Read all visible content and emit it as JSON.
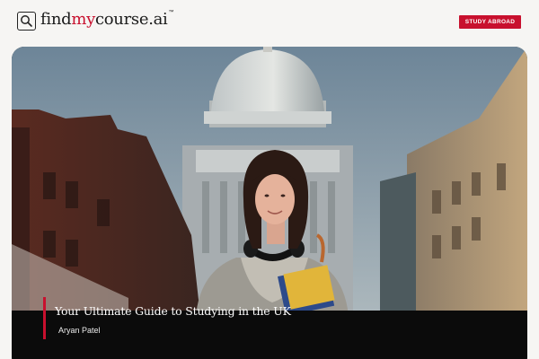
{
  "brand": {
    "name_prefix": "find",
    "name_accent": "my",
    "name_suffix": "course.ai",
    "trademark": "™",
    "accent_color": "#c8102e"
  },
  "header": {
    "cta_label": "STUDY ABROAD"
  },
  "hero": {
    "title": "Your Ultimate Guide to Studying in the UK",
    "author": "Aryan Patel",
    "image_subject": "student-in-london-street-with-dome"
  }
}
